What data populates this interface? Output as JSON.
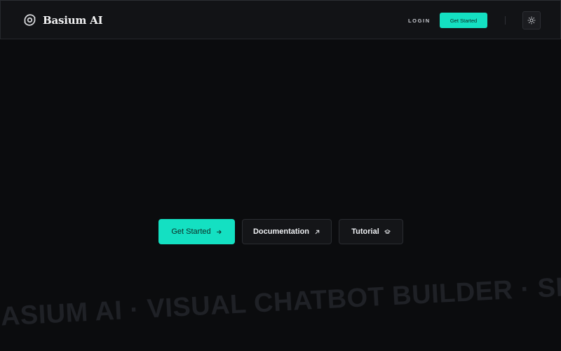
{
  "header": {
    "brand_name": "Basium AI",
    "login_label": "LOGIN",
    "cta_label": "Get Started",
    "theme_icon": "sun-icon"
  },
  "hero": {
    "buttons": [
      {
        "label": "Get Started",
        "icon": "arrow-right-icon"
      },
      {
        "label": "Documentation",
        "icon": "arrow-up-right-icon"
      },
      {
        "label": "Tutorial",
        "icon": "graduation-cap-icon"
      }
    ]
  },
  "marquee": {
    "text": "BASIUM AI · VISUAL CHATBOT BUILDER · SHIPS TO"
  },
  "colors": {
    "background": "#0b0c0e",
    "header_background": "#121316",
    "accent": "#14e0c2",
    "secondary_button": "#141518"
  }
}
